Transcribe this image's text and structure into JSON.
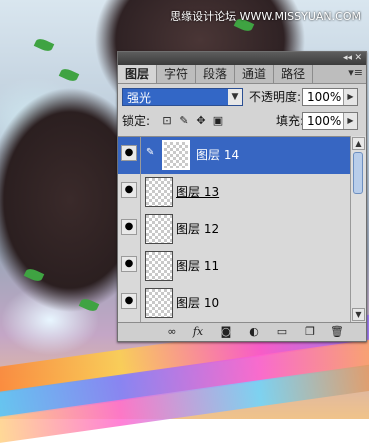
{
  "watermark": "思缘设计论坛 WWW.MISSYUAN.COM",
  "panel": {
    "tabs": [
      "图层",
      "字符",
      "段落",
      "通道",
      "路径"
    ],
    "blend_mode": "强光",
    "opacity_label": "不透明度:",
    "opacity_value": "100%",
    "lock_label": "锁定:",
    "fill_label": "填充:",
    "fill_value": "100%",
    "layers": [
      "图层 14",
      "图层 13",
      "图层 12",
      "图层 11",
      "图层 10"
    ],
    "colors": {
      "accent": "#3766c2",
      "panel_bg": "#d4d4d4"
    }
  }
}
